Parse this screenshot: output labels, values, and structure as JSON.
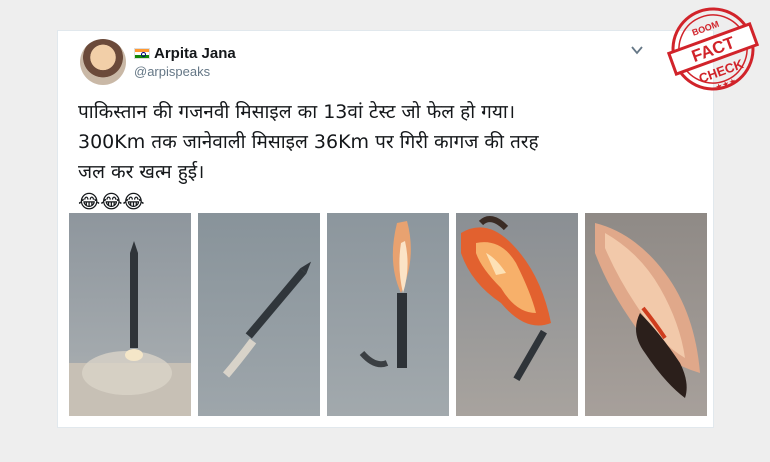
{
  "tweet": {
    "display_name": "Arpita Jana",
    "handle": "@arpispeaks",
    "flag_icon": "india-flag-icon",
    "text_lines": [
      "पाकिस्तान की गजनवी मिसाइल का 13वां टेस्ट जो फेल हो गया।",
      "300Km तक जानेवाली मिसाइल 36Km पर गिरी कागज की तरह",
      "जल कर खत्म हुई।"
    ],
    "emojis": "😂😂😂",
    "caret_icon": "chevron-down-icon"
  },
  "photos": [
    {
      "name": "missile-launch-photo-1"
    },
    {
      "name": "missile-launch-photo-2"
    },
    {
      "name": "missile-launch-photo-3"
    },
    {
      "name": "missile-launch-photo-4"
    },
    {
      "name": "missile-launch-photo-5"
    }
  ],
  "badge": {
    "small": "BOOM",
    "line1": "FACT",
    "line2": "CHECK",
    "color": "#d1232a"
  }
}
